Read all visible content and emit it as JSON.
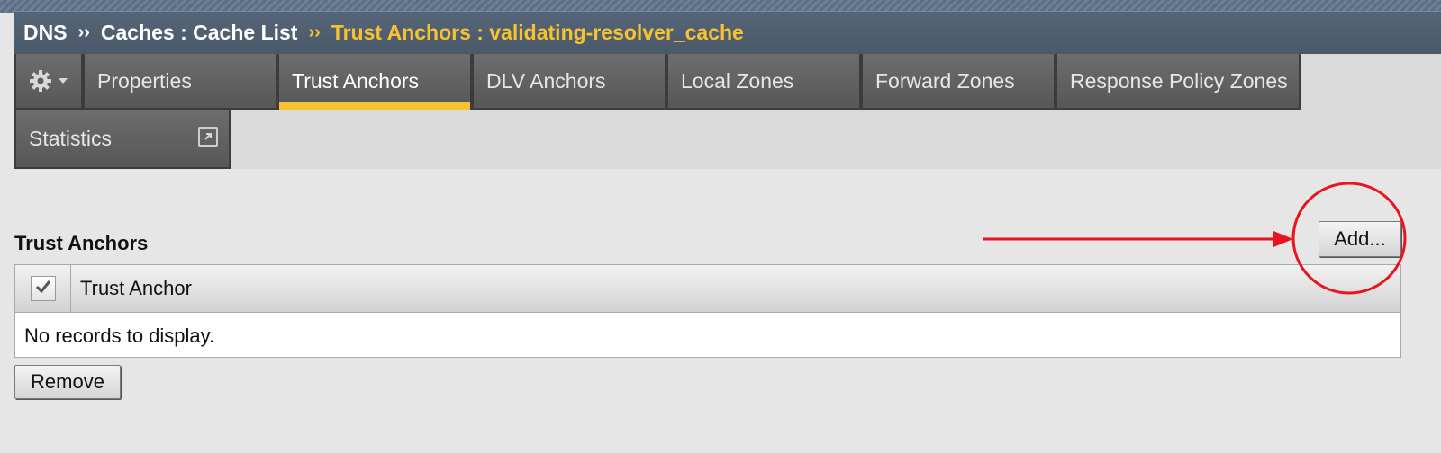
{
  "breadcrumb": {
    "root": "DNS",
    "separator": "››",
    "parent": "Caches : Cache List",
    "current": "Trust Anchors : validating-resolver_cache"
  },
  "tabs": [
    {
      "label": "Properties",
      "active": false
    },
    {
      "label": "Trust Anchors",
      "active": true
    },
    {
      "label": "DLV Anchors",
      "active": false
    },
    {
      "label": "Local Zones",
      "active": false
    },
    {
      "label": "Forward Zones",
      "active": false
    },
    {
      "label": "Response Policy Zones",
      "active": false
    },
    {
      "label": "Statistics",
      "active": false
    }
  ],
  "icons": {
    "settings": "gear-icon",
    "menu": "chevron-down-icon",
    "external": "external-link-icon",
    "check": "checkmark-icon"
  },
  "section": {
    "title": "Trust Anchors",
    "add_label": "Add...",
    "remove_label": "Remove"
  },
  "table": {
    "columns": [
      "Trust Anchor"
    ],
    "rows": [],
    "empty_message": "No records to display."
  },
  "colors": {
    "accent": "#f5c232",
    "header_bg": "#4f5f71",
    "tab_bg": "#606060",
    "annotation": "#e8141e"
  }
}
